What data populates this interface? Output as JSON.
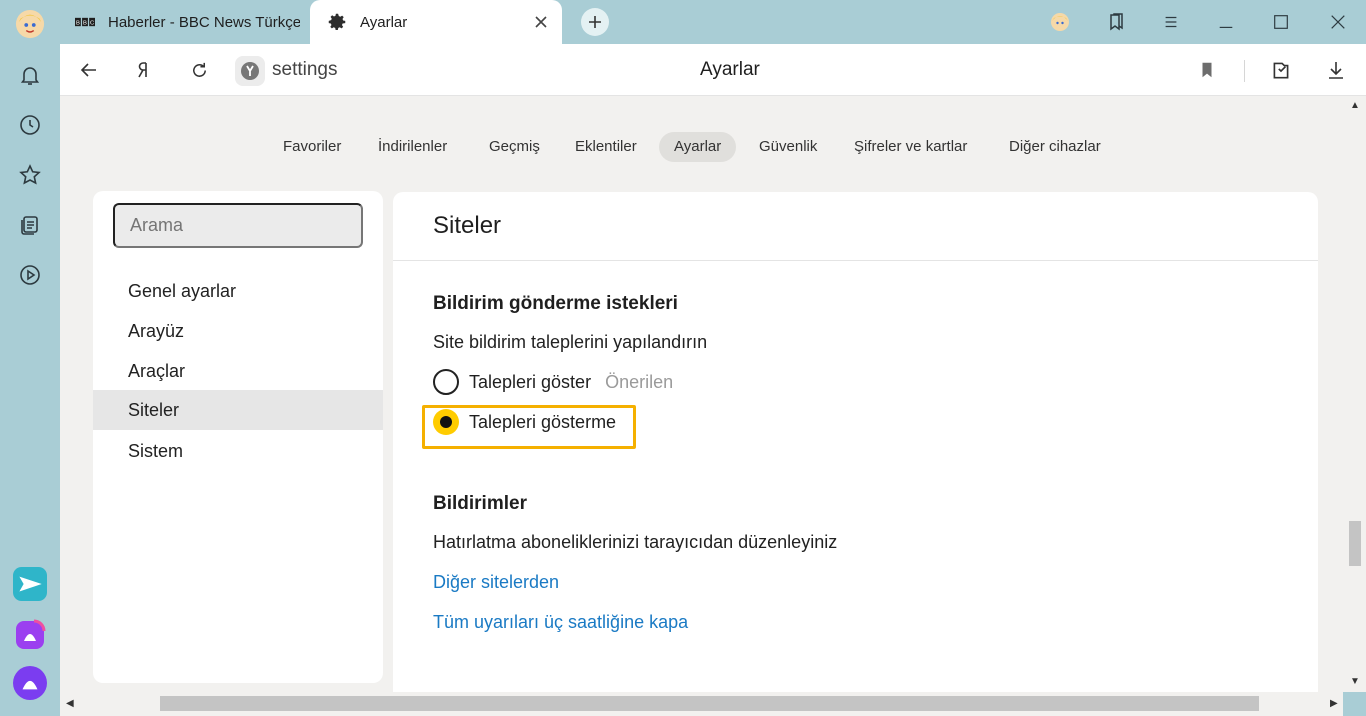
{
  "tabs": [
    {
      "title": "Haberler - BBC News Türkçe",
      "favicon": "bbc-icon",
      "active": false
    },
    {
      "title": "Ayarlar",
      "favicon": "gear-icon",
      "active": true
    }
  ],
  "toolbar": {
    "address": "settings",
    "page_title": "Ayarlar"
  },
  "topnav": {
    "items": [
      "Favoriler",
      "İndirilenler",
      "Geçmiş",
      "Eklentiler",
      "Ayarlar",
      "Güvenlik",
      "Şifreler ve kartlar",
      "Diğer cihazlar"
    ],
    "selected": "Ayarlar"
  },
  "settings_menu": {
    "search_placeholder": "Arama",
    "items": [
      "Genel ayarlar",
      "Arayüz",
      "Araçlar",
      "Siteler",
      "Sistem"
    ],
    "selected": "Siteler"
  },
  "content": {
    "section_title": "Siteler",
    "notification_requests": {
      "heading": "Bildirim gönderme istekleri",
      "description": "Site bildirim taleplerini yapılandırın",
      "options": [
        {
          "label": "Talepleri göster",
          "hint": "Önerilen",
          "checked": false
        },
        {
          "label": "Talepleri gösterme",
          "hint": "",
          "checked": true
        }
      ]
    },
    "notifications": {
      "heading": "Bildirimler",
      "description": "Hatırlatma aboneliklerinizi tarayıcıdan düzenleyiniz",
      "links": [
        "Diğer sitelerden",
        "Tüm uyarıları üç saatliğine kapa"
      ]
    }
  },
  "colors": {
    "accent_yellow": "#ffcc00",
    "focus_ring": "#f5b000",
    "link_blue": "#1a7ac4",
    "chrome_bg": "#a9cdd5",
    "page_bg": "#f2f1ef"
  }
}
